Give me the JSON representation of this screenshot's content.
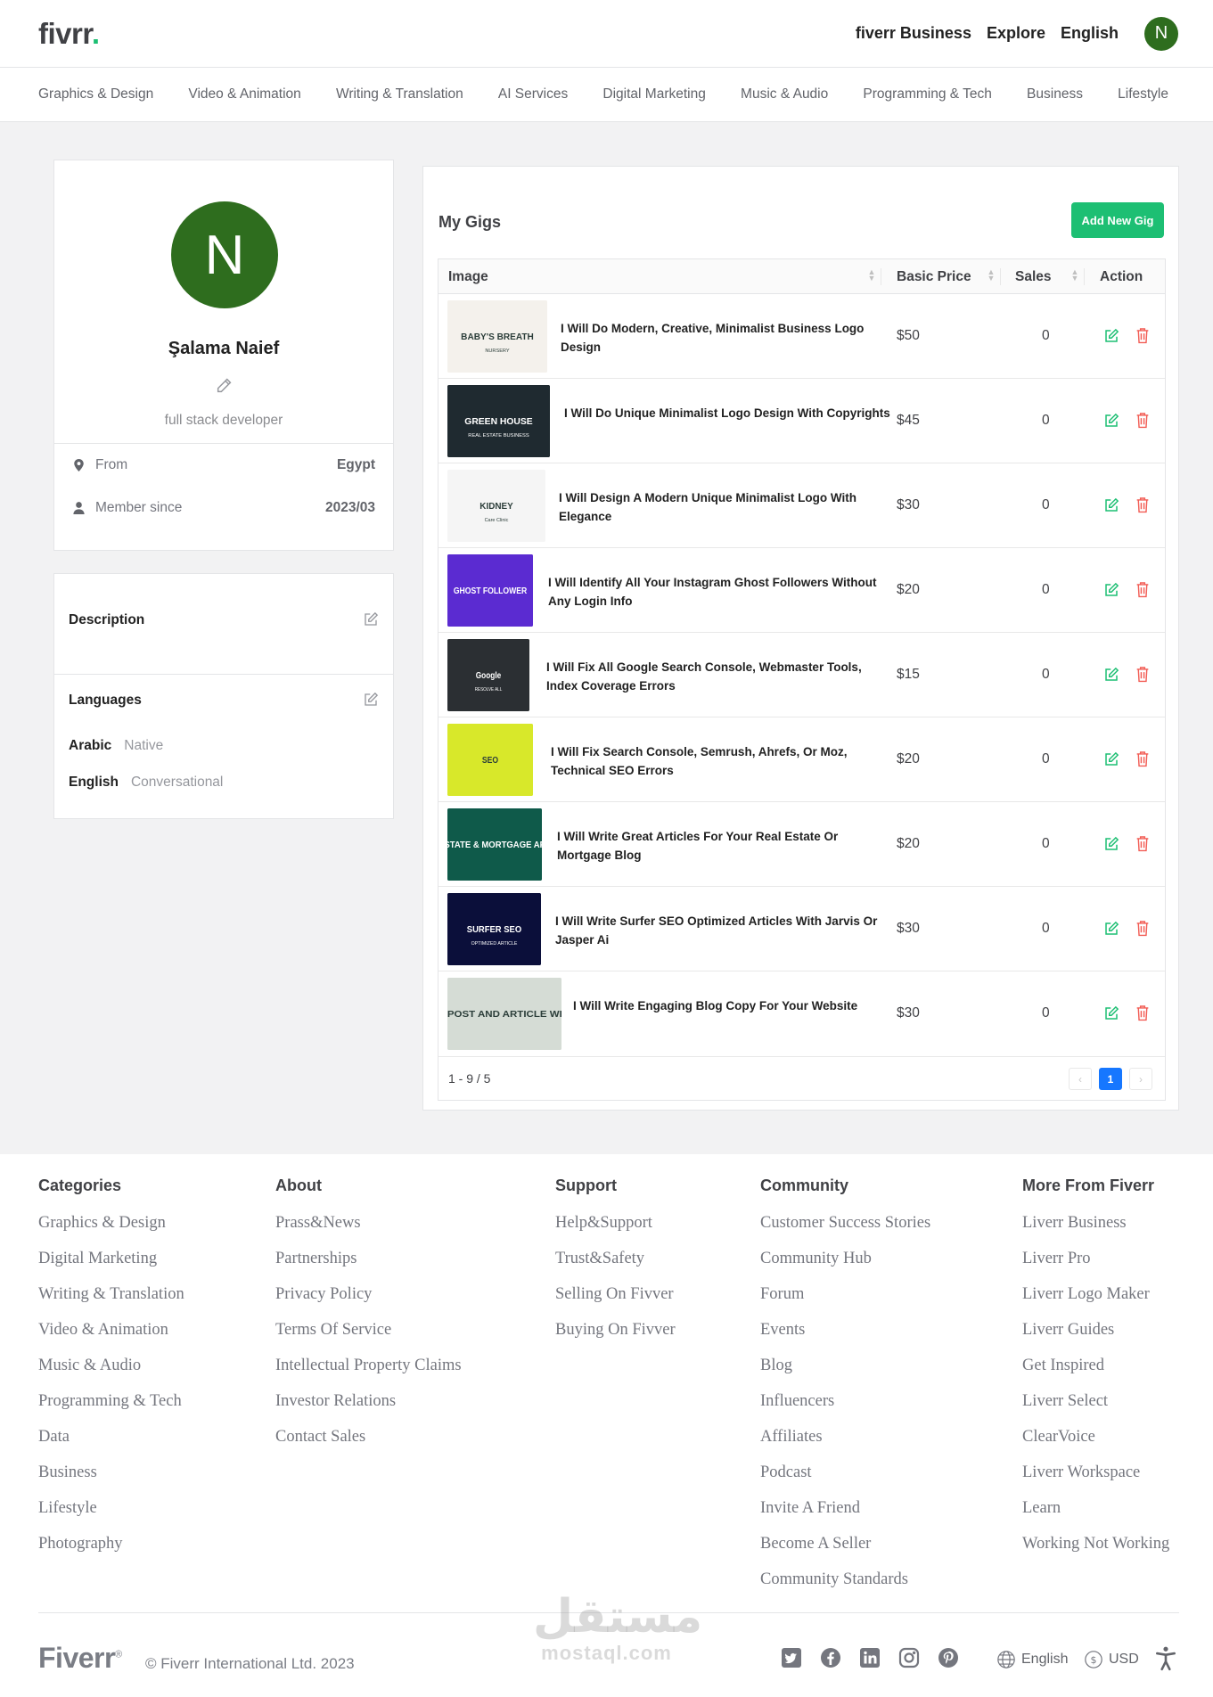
{
  "header": {
    "logo": "fivrr",
    "logo_dot": ".",
    "links": [
      "fiverr Business",
      "Explore",
      "English"
    ],
    "avatar_letter": "N"
  },
  "categories": [
    "Graphics & Design",
    "Video & Animation",
    "Writing & Translation",
    "AI Services",
    "Digital Marketing",
    "Music & Audio",
    "Programming & Tech",
    "Business",
    "Lifestyle"
  ],
  "profile": {
    "avatar_letter": "N",
    "name": "Şalama Naief",
    "role": "full stack developer",
    "from_label": "From",
    "from_value": "Egypt",
    "member_label": "Member since",
    "member_value": "2023/03"
  },
  "description": {
    "title": "Description",
    "languages_title": "Languages",
    "languages": [
      {
        "name": "Arabic",
        "level": "Native"
      },
      {
        "name": "English",
        "level": "Conversational"
      }
    ]
  },
  "gigs": {
    "title": "My Gigs",
    "add_label": "Add New Gig",
    "columns": {
      "image": "Image",
      "price": "Basic Price",
      "sales": "Sales",
      "action": "Action"
    },
    "rows": [
      {
        "title": "I Will Do Modern, Creative, Minimalist Business Logo Design",
        "price": "$50",
        "sales": "0",
        "thumb_text": "BABY'S BREATH",
        "thumb_sub": "NURSERY",
        "thumb_bg": "#f4f1ec"
      },
      {
        "title": "I Will Do Unique Minimalist Logo Design With Copyrights",
        "price": "$45",
        "sales": "0",
        "thumb_text": "GREEN HOUSE",
        "thumb_sub": "REAL ESTATE BUSINESS",
        "thumb_bg": "#1f2a30"
      },
      {
        "title": "I Will Design A Modern Unique Minimalist Logo With Elegance",
        "price": "$30",
        "sales": "0",
        "thumb_text": "KIDNEY",
        "thumb_sub": "Care Clinic",
        "thumb_bg": "#f5f5f5"
      },
      {
        "title": "I Will Identify All Your Instagram Ghost Followers Without Any Login Info",
        "price": "$20",
        "sales": "0",
        "thumb_text": "GHOST FOLLOWER",
        "thumb_sub": "",
        "thumb_bg": "#5b2bd1"
      },
      {
        "title": "I Will Fix All Google Search Console, Webmaster Tools, Index Coverage Errors",
        "price": "$15",
        "sales": "0",
        "thumb_text": "Google",
        "thumb_sub": "RESOLVE ALL",
        "thumb_bg": "#2b2f33"
      },
      {
        "title": "I Will Fix Search Console, Semrush, Ahrefs, Or Moz, Technical SEO Errors",
        "price": "$20",
        "sales": "0",
        "thumb_text": "SEO",
        "thumb_sub": "",
        "thumb_bg": "#d8e82a"
      },
      {
        "title": "I Will Write Great Articles For Your Real Estate Or Mortgage Blog",
        "price": "$20",
        "sales": "0",
        "thumb_text": "REAL ESTATE & MORTGAGE ARTICLES",
        "thumb_sub": "",
        "thumb_bg": "#0f5a4a"
      },
      {
        "title": "I Will Write Surfer SEO Optimized Articles With Jarvis Or Jasper Ai",
        "price": "$30",
        "sales": "0",
        "thumb_text": "SURFER SEO",
        "thumb_sub": "OPTIMIZED ARTICLE",
        "thumb_bg": "#0b0f3a"
      },
      {
        "title": "I Will Write Engaging Blog Copy For Your Website",
        "price": "$30",
        "sales": "0",
        "thumb_text": "BLOG POST AND ARTICLE WRITING",
        "thumb_sub": "",
        "thumb_bg": "#d5dcd5"
      }
    ],
    "total": "1 - 9 / 5",
    "page": "1",
    "prev": "‹",
    "next": "›"
  },
  "footer": {
    "columns": [
      {
        "title": "Categories",
        "links": [
          "Graphics & Design",
          "Digital Marketing",
          "Writing & Translation",
          "Video & Animation",
          "Music & Audio",
          "Programming & Tech",
          "Data",
          "Business",
          "Lifestyle",
          "Photography"
        ]
      },
      {
        "title": "About",
        "links": [
          "Prass&News",
          "Partnerships",
          "Privacy Policy",
          "Terms Of Service",
          "Intellectual Property Claims",
          "Investor Relations",
          "Contact Sales"
        ]
      },
      {
        "title": "Support",
        "links": [
          "Help&Support",
          "Trust&Safety",
          "Selling On Fivver",
          "Buying On Fivver"
        ]
      },
      {
        "title": "Community",
        "links": [
          "Customer Success Stories",
          "Community Hub",
          "Forum",
          "Events",
          "Blog",
          "Influencers",
          "Affiliates",
          "Podcast",
          "Invite A Friend",
          "Become A Seller",
          "Community Standards"
        ]
      },
      {
        "title": "More From Fiverr",
        "links": [
          "Liverr Business",
          "Liverr Pro",
          "Liverr Logo Maker",
          "Liverr Guides",
          "Get Inspired",
          "Liverr Select",
          "ClearVoice",
          "Liverr Workspace",
          "Learn",
          "Working Not Working"
        ]
      }
    ],
    "logo": "Fiverr",
    "logo_mark": "®",
    "copyright": "© Fiverr International Ltd. 2023",
    "language": "English",
    "currency": "USD"
  },
  "watermark": {
    "arabic": "مستقل",
    "latin": "mostaql.com"
  },
  "colors": {
    "brand_green": "#1dbf73",
    "avatar_green": "#2e6d1e",
    "edit_green": "#1dbf73",
    "delete_red": "#f25c54",
    "page_blue": "#1677ff"
  }
}
